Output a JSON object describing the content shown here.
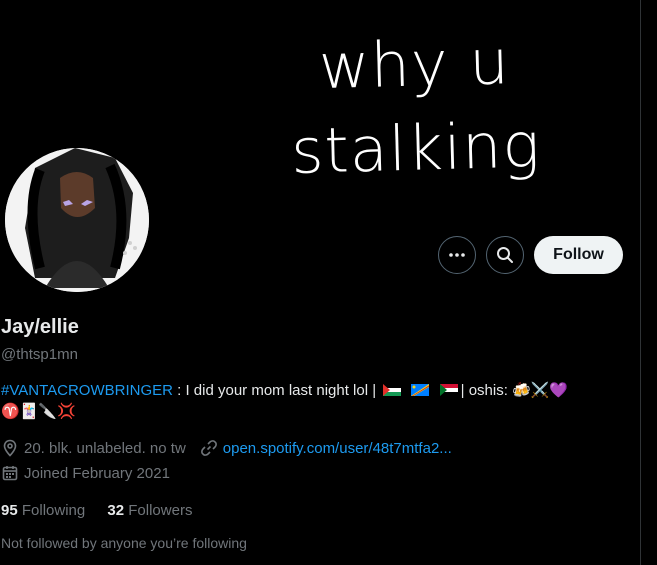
{
  "banner": {
    "line1": "why u",
    "line2": "stalking"
  },
  "profile": {
    "name": "Jay/ellie",
    "handle": "@thtsp1mn",
    "bio_hashtag": "#VANTACROWBRINGER",
    "bio_text": " : I did your mom last night lol |",
    "bio_flags_after": "| oshis: ",
    "bio_emojis_line1": "🍻⚔️💜",
    "bio_emojis_line2": "♈🃏🔪💢",
    "location": "20. blk. unlabeled. no tw",
    "website": "open.spotify.com/user/48t7mtfa2...",
    "joined": "Joined February 2021",
    "following_count": "95",
    "following_label": "Following",
    "followers_count": "32",
    "followers_label": "Followers",
    "not_followed": "Not followed by anyone you’re following"
  },
  "actions": {
    "more_icon": "more-dots-icon",
    "search_icon": "search-icon",
    "follow_label": "Follow"
  },
  "colors": {
    "link": "#1d9bf0",
    "muted": "#71767b",
    "text": "#e7e9ea",
    "button_bg": "#eff3f4"
  }
}
